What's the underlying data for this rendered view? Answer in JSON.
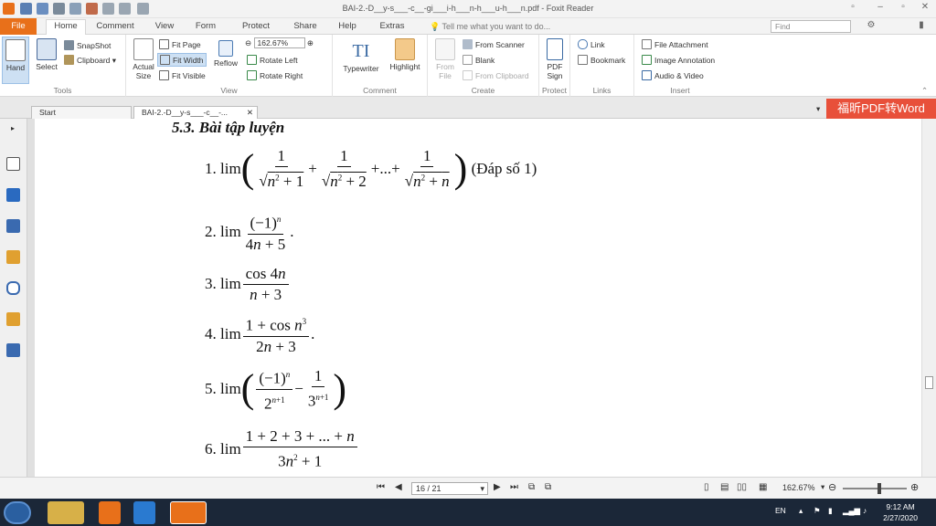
{
  "window": {
    "title": "BAI-2.-D__y-s___-c__-gi___i-h___n-h___u-h___n.pdf - Foxit Reader"
  },
  "menu_tabs": [
    "File",
    "Home",
    "Comment",
    "View",
    "Form",
    "Protect",
    "Share",
    "Help",
    "Extras"
  ],
  "tell_me": "Tell me what you want to do...",
  "find_placeholder": "Find",
  "ribbon": {
    "tools": {
      "hand": "Hand",
      "select": "Select",
      "snapshot": "SnapShot",
      "clipboard": "Clipboard",
      "label": "Tools"
    },
    "view": {
      "actual_size": "Actual Size",
      "fit_page": "Fit Page",
      "fit_width": "Fit Width",
      "fit_visible": "Fit Visible",
      "reflow": "Reflow",
      "zoom": "162.67%",
      "rotate_left": "Rotate Left",
      "rotate_right": "Rotate Right",
      "label": "View"
    },
    "comment": {
      "typewriter": "Typewriter",
      "highlight": "Highlight",
      "label": "Comment"
    },
    "create": {
      "from_file": "From File",
      "from_scanner": "From Scanner",
      "blank": "Blank",
      "from_clipboard": "From Clipboard",
      "label": "Create"
    },
    "protect": {
      "pdf_sign": "PDF Sign",
      "label": "Protect"
    },
    "links": {
      "link": "Link",
      "bookmark": "Bookmark",
      "label": "Links"
    },
    "insert": {
      "file_attachment": "File Attachment",
      "image_annotation": "Image Annotation",
      "audio_video": "Audio & Video",
      "label": "Insert"
    }
  },
  "doc_tabs": {
    "start": "Start",
    "doc": "BAI-2.-D__y-s___-c__-..."
  },
  "promo": "福昕PDF转Word",
  "document": {
    "heading": "5.3. Bài tập luyện",
    "exercises": [
      {
        "n": "1.",
        "note": "(Đáp số 1)"
      },
      {
        "n": "2."
      },
      {
        "n": "3."
      },
      {
        "n": "4."
      },
      {
        "n": "5."
      },
      {
        "n": "6."
      }
    ]
  },
  "statusbar": {
    "page": "16 / 21",
    "zoom": "162.67%"
  },
  "taskbar": {
    "lang": "EN",
    "time": "9:12 AM",
    "date": "2/27/2020"
  }
}
